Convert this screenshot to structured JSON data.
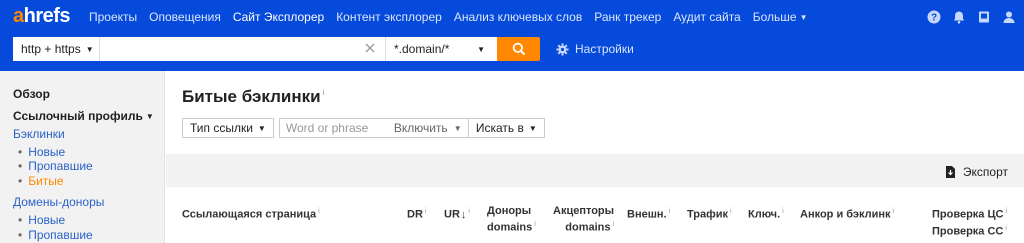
{
  "logo": {
    "a": "a",
    "rest": "hrefs"
  },
  "nav": {
    "items": [
      "Проекты",
      "Оповещения",
      "Сайт Эксплорер",
      "Контент эксплорер",
      "Анализ ключевых слов",
      "Ранк трекер",
      "Аудит сайта",
      "Больше"
    ],
    "active": "Сайт Эксплорер"
  },
  "header_icons": [
    "help-icon",
    "bell-icon",
    "book-icon",
    "user-icon"
  ],
  "search": {
    "protocol": "http + https",
    "target_value": "",
    "target_placeholder": "",
    "mode": "*.domain/*",
    "settings_label": "Настройки"
  },
  "sidebar": {
    "overview": "Обзор",
    "profile": "Ссылочный профиль",
    "backlinks": "Бэклинки",
    "backlinks_sub": [
      "Новые",
      "Пропавшие",
      "Битые"
    ],
    "ref_domains": "Домены-доноры",
    "ref_domains_sub": [
      "Новые",
      "Пропавшие"
    ]
  },
  "main": {
    "title": "Битые бэклинки",
    "filters": {
      "link_type": "Тип ссылки",
      "phrase_placeholder": "Word or phrase",
      "include": "Включить",
      "search_in": "Искать в"
    },
    "export_label": "Экспорт",
    "columns": {
      "referring_page": "Ссылающаяся страница",
      "dr": "DR",
      "ur": "UR",
      "donors_1": "Доноры",
      "donors_2": "domains",
      "acceptors_1": "Акцепторы",
      "acceptors_2": "domains",
      "external": "Внешн.",
      "traffic": "Трафик",
      "keywords": "Ключ.",
      "anchor": "Анкор и бэклинк",
      "check_1": "Проверка ЦС",
      "check_2": "Проверка СС"
    }
  },
  "colors": {
    "header_bg": "#054ada",
    "accent": "#ff8800",
    "link": "#2a62c9"
  }
}
